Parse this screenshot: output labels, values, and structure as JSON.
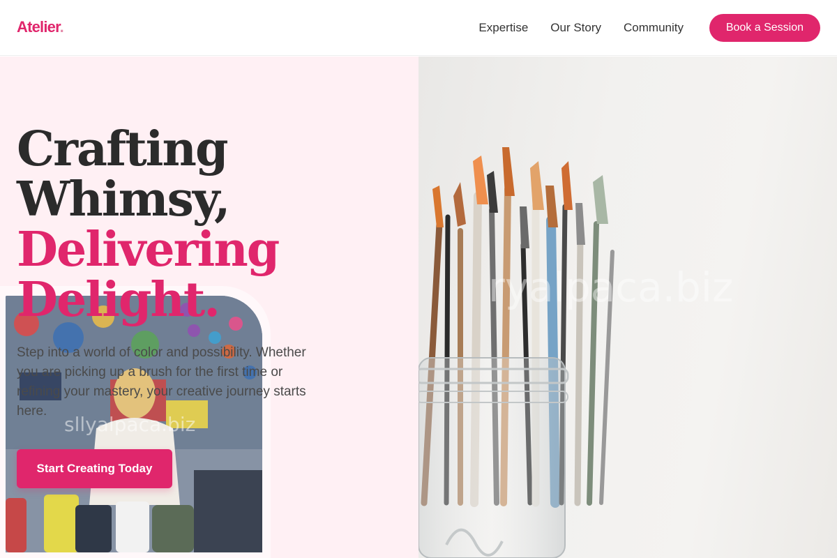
{
  "header": {
    "logo": "Atelier",
    "logo_dot": ".",
    "nav": [
      "Expertise",
      "Our Story",
      "Community"
    ],
    "cta": "Book a Session"
  },
  "hero": {
    "title_line1": "Crafting",
    "title_line2": "Whimsy,",
    "title_line3": "Delivering",
    "title_line4": "Delight.",
    "description": "Step into a world of color and possibility. Whether you are picking up a brush for the first time or refining your mastery, your creative journey starts here.",
    "button": "Start Creating Today"
  },
  "images": {
    "hero_photo": "paintbrushes-in-glass-jar",
    "inset_photo": "girl-painting-in-studio"
  },
  "watermarks": [
    "ryalpaca.biz",
    "sllyalpaca.biz"
  ],
  "colors": {
    "accent": "#e0266c",
    "panel": "#fff0f4",
    "text": "#2b2b2b"
  }
}
